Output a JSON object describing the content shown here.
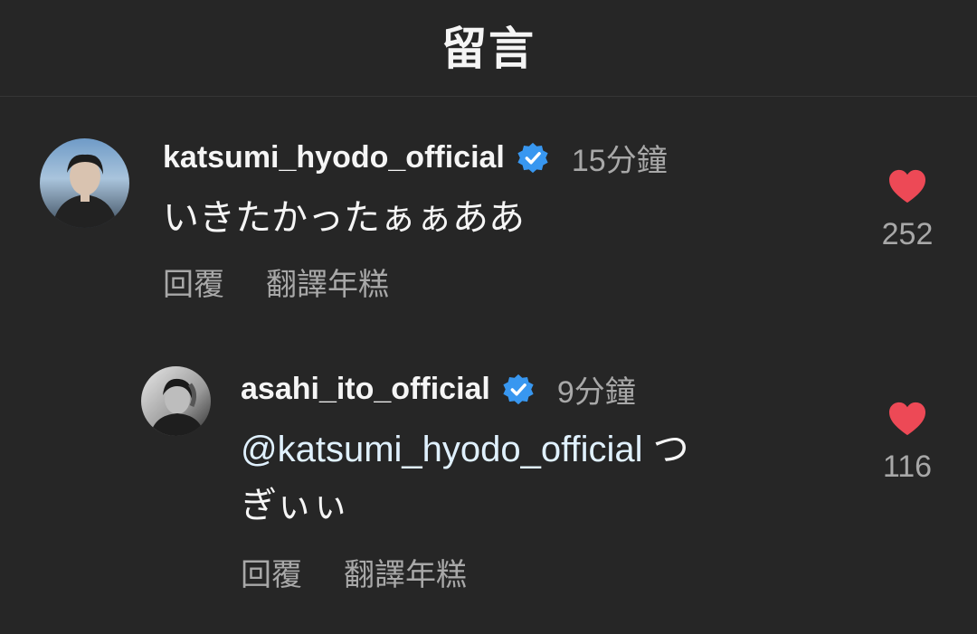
{
  "header": {
    "title": "留言"
  },
  "comments": [
    {
      "username": "katsumi_hyodo_official",
      "time": "15分鐘",
      "text": "いきたかったぁぁああ",
      "reply_label": "回覆",
      "translate_label": "翻譯年糕",
      "like_count": "252"
    },
    {
      "username": "asahi_ito_official",
      "time": "9分鐘",
      "mention": "@katsumi_hyodo_official",
      "text_line1_rest": " つ",
      "text_line2": "ぎぃぃ",
      "reply_label": "回覆",
      "translate_label": "翻譯年糕",
      "like_count": "116"
    }
  ],
  "colors": {
    "background": "#262626",
    "verified": "#3897f0",
    "like": "#ed4956",
    "secondary_text": "#a8a8a8"
  }
}
